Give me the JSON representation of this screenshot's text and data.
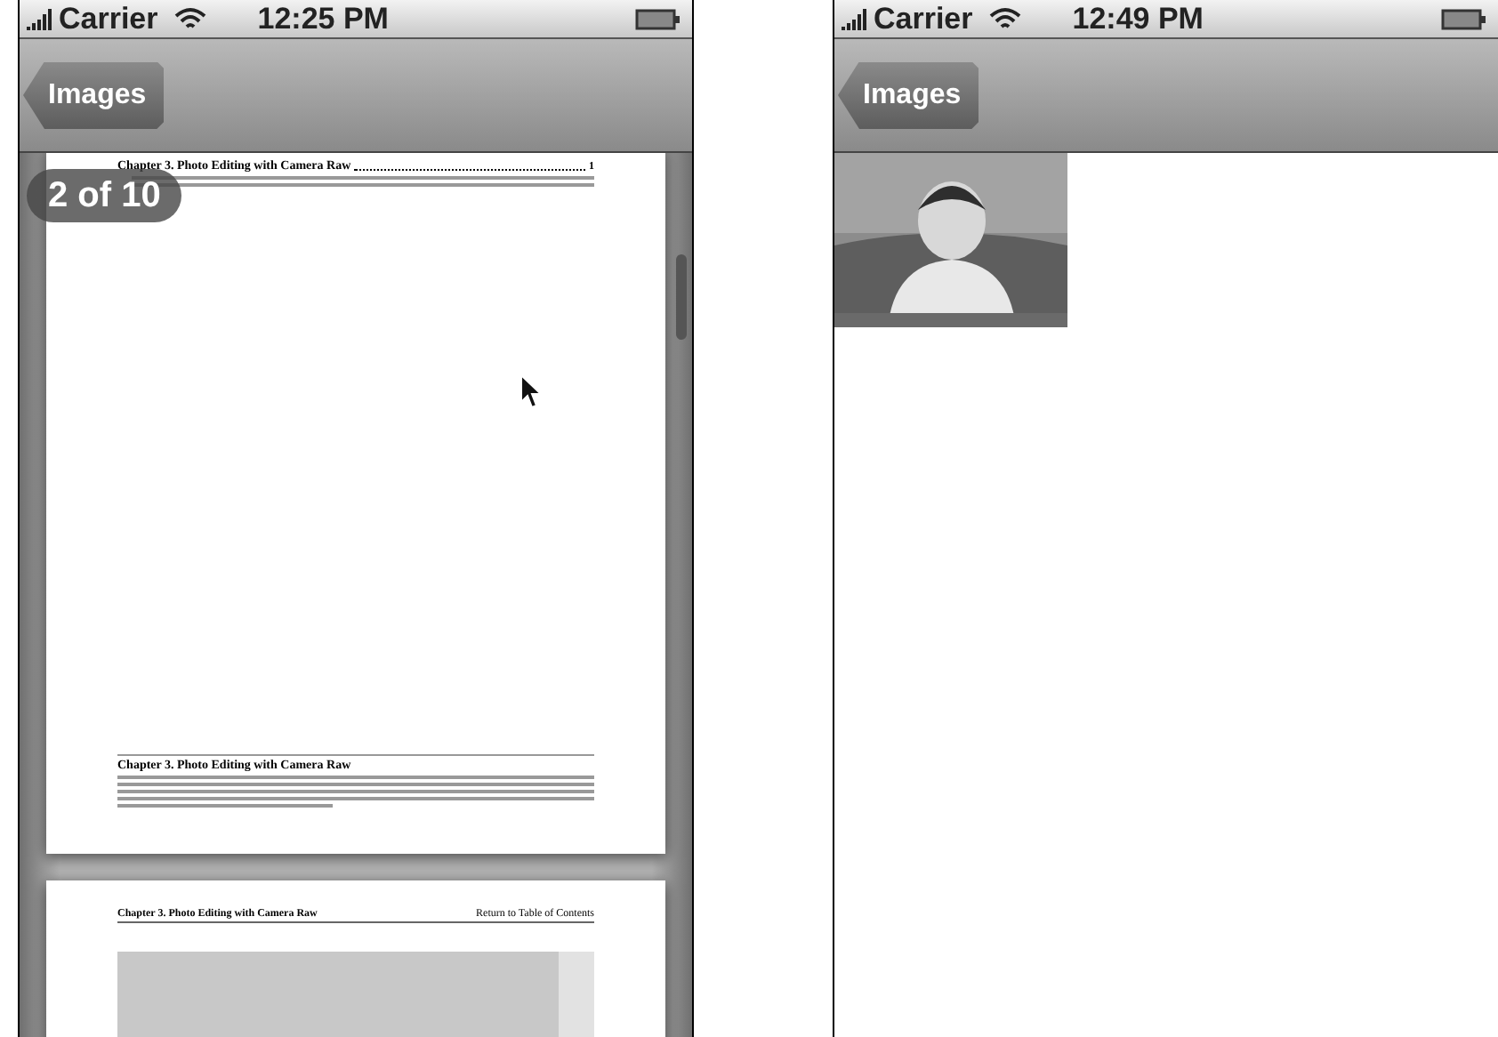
{
  "phones": [
    {
      "status_bar": {
        "carrier": "Carrier",
        "time": "12:25 PM"
      },
      "nav_bar": {
        "back_button": "Images"
      },
      "content": {
        "kind": "document",
        "page_badge": "2 of 10",
        "pages": [
          {
            "toc_title": "Chapter 3. Photo Editing with Camera Raw",
            "toc_page": "1",
            "footer_title": "Chapter 3. Photo Editing with Camera Raw"
          },
          {
            "header_title": "Chapter 3. Photo Editing with Camera Raw",
            "header_link": "Return to Table of Contents"
          }
        ]
      }
    },
    {
      "status_bar": {
        "carrier": "Carrier",
        "time": "12:49 PM"
      },
      "nav_bar": {
        "back_button": "Images"
      },
      "content": {
        "kind": "gallery"
      }
    }
  ]
}
